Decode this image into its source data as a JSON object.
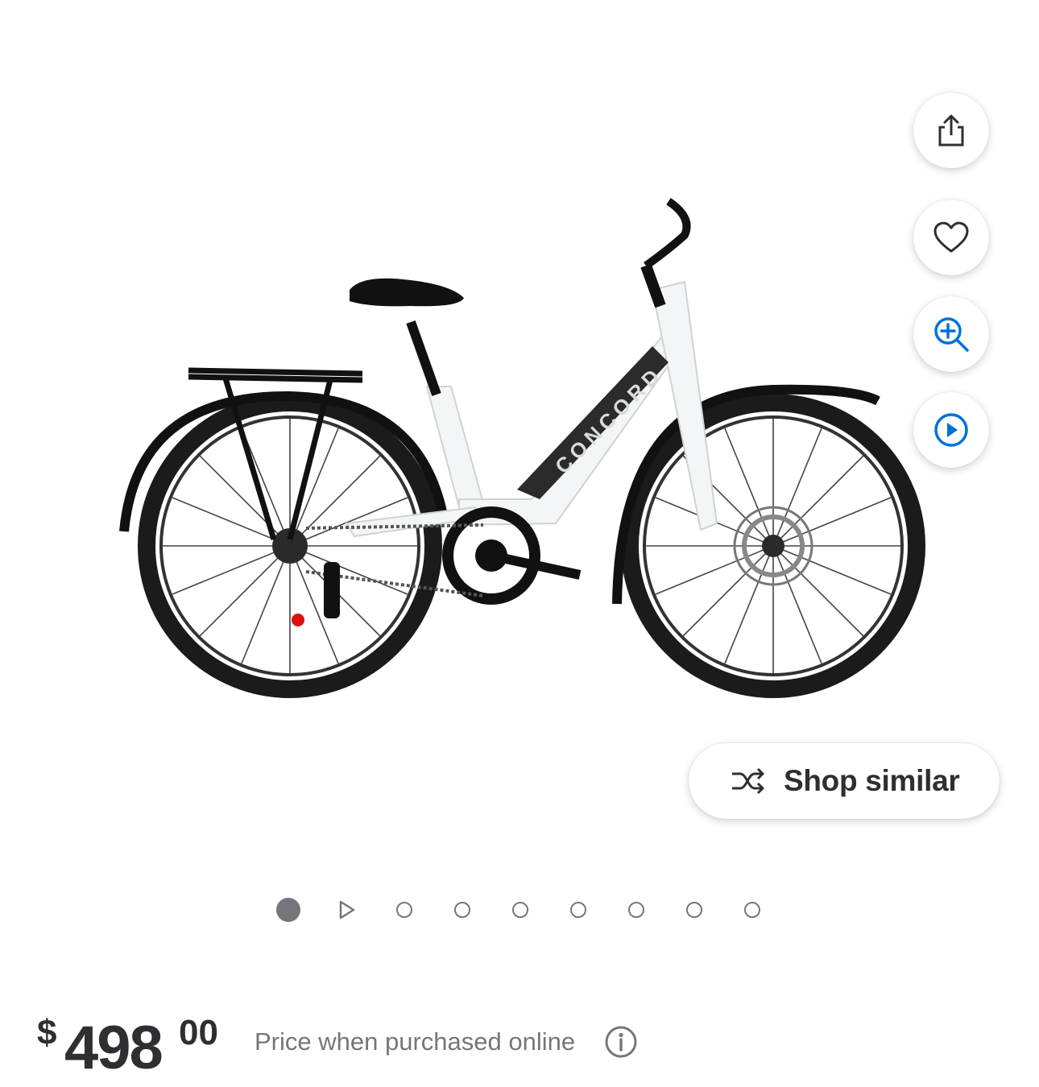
{
  "product": {
    "image_alt": "White Concord step-through electric bike with rear rack",
    "brand_on_frame": "CONCORD"
  },
  "actions": {
    "share_icon": "share-icon",
    "favorite_icon": "heart-icon",
    "zoom_icon": "zoom-in-icon",
    "video_icon": "play-icon"
  },
  "shop_similar": {
    "label": "Shop similar",
    "icon": "shuffle-icon"
  },
  "carousel": {
    "active_index": 0,
    "items": [
      "image",
      "video",
      "image",
      "image",
      "image",
      "image",
      "image",
      "image",
      "image"
    ]
  },
  "price": {
    "currency": "$",
    "dollars": "498",
    "cents": "00",
    "note": "Price when purchased online",
    "info_icon": "info-icon"
  },
  "colors": {
    "text_dark": "#2e2f32",
    "text_muted": "#74767c",
    "accent_blue": "#0071dc"
  }
}
